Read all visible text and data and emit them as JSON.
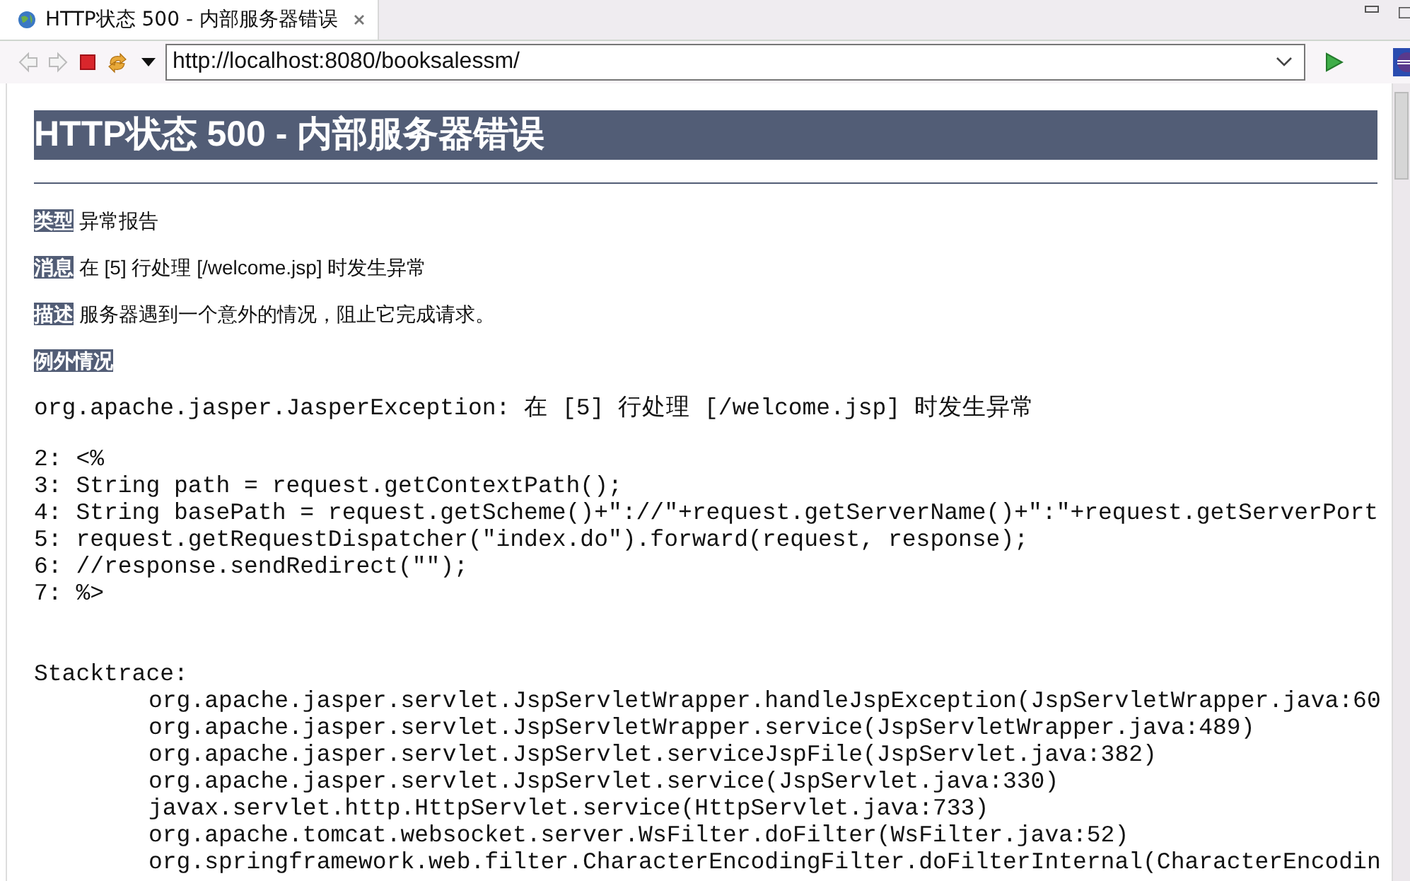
{
  "tab": {
    "title": "HTTP状态 500 - 内部服务器错误"
  },
  "nav_buttons": [
    {
      "kind": "back",
      "disabled": true
    },
    {
      "kind": "forward",
      "disabled": true
    },
    {
      "kind": "stop",
      "disabled": false
    },
    {
      "kind": "refresh",
      "disabled": false
    }
  ],
  "address": {
    "value": "http://localhost:8080/booksalessm/"
  },
  "page": {
    "heading": "HTTP状态 500 - 内部服务器错误",
    "fields": [
      {
        "label": "类型",
        "value": "异常报告"
      },
      {
        "label": "消息",
        "value": "在 [5] 行处理 [/welcome.jsp] 时发生异常"
      },
      {
        "label": "描述",
        "value": "服务器遇到一个意外的情况，阻止它完成请求。"
      }
    ],
    "exception_label": "例外情况",
    "exception": "org.apache.jasper.JasperException: 在 [5] 行处理 [/welcome.jsp] 时发生异常",
    "source_lines": [
      "2: <%",
      "3: String path = request.getContextPath();",
      "4: String basePath = request.getScheme()+\"://\"+request.getServerName()+\":\"+request.getServerPort",
      "5: request.getRequestDispatcher(\"index.do\").forward(request, response);",
      "6: //response.sendRedirect(\"\");",
      "7: %>"
    ],
    "stacktrace_label": "Stacktrace:",
    "stacktrace": [
      "org.apache.jasper.servlet.JspServletWrapper.handleJspException(JspServletWrapper.java:60",
      "org.apache.jasper.servlet.JspServletWrapper.service(JspServletWrapper.java:489)",
      "org.apache.jasper.servlet.JspServlet.serviceJspFile(JspServlet.java:382)",
      "org.apache.jasper.servlet.JspServlet.service(JspServlet.java:330)",
      "javax.servlet.http.HttpServlet.service(HttpServlet.java:733)",
      "org.apache.tomcat.websocket.server.WsFilter.doFilter(WsFilter.java:52)",
      "org.springframework.web.filter.CharacterEncodingFilter.doFilterInternal(CharacterEncodin"
    ]
  }
}
